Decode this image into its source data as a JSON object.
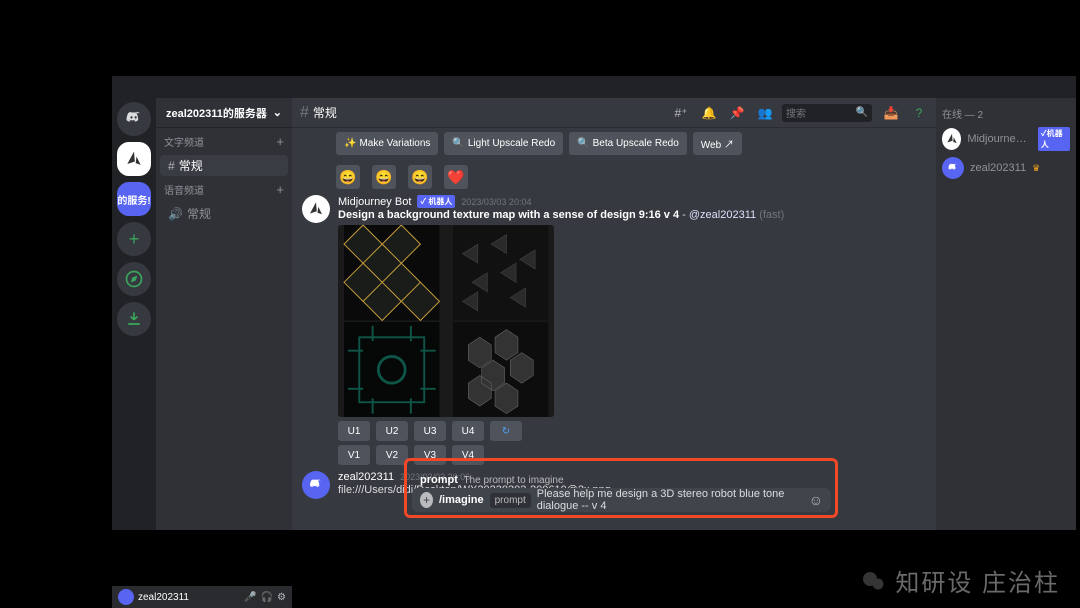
{
  "server_name": "zeal202311的服务器",
  "channel_hash": "#",
  "current_channel": "常规",
  "categories": {
    "text": {
      "label": "文字频道",
      "items": [
        {
          "name": "常规"
        }
      ]
    },
    "voice": {
      "label": "语音频道",
      "items": [
        {
          "name": "常规"
        }
      ]
    }
  },
  "header_icons": [
    "hash-icon",
    "bell-icon",
    "pin-icon",
    "members-icon"
  ],
  "search_placeholder": "搜索",
  "action_buttons": [
    {
      "icon": "✨",
      "label": "Make Variations"
    },
    {
      "icon": "🔍",
      "label": "Light Upscale Redo"
    },
    {
      "icon": "🔍",
      "label": "Beta Upscale Redo"
    },
    {
      "icon": "",
      "label": "Web ↗"
    }
  ],
  "reaction_emojis": [
    "😄",
    "😄",
    "😄",
    "❤️"
  ],
  "bot_msg": {
    "author": "Midjourney Bot",
    "bot_tag": "✓ 机器人",
    "timestamp": "2023/03/03 20:04",
    "text_prefix": "Design a background texture map with a sense of design 9:16 v 4",
    "mention": "@zeal202311",
    "suffix": "(fast)",
    "u_buttons": [
      "U1",
      "U2",
      "U3",
      "U4"
    ],
    "cycle": "↻",
    "v_buttons": [
      "V1",
      "V2",
      "V3",
      "V4"
    ]
  },
  "user_msg": {
    "author": "zeal202311",
    "timestamp": "2023/03/03 20:06",
    "text": "file:///Users/didi/Desktop/WX20230303-200610@2x.png"
  },
  "prompt_hint": {
    "label": "prompt",
    "desc": "The prompt to imagine"
  },
  "input": {
    "command": "/imagine",
    "param": "prompt",
    "value": "Please help me design a 3D stereo robot blue tone dialogue -- v 4"
  },
  "members_header": "在线 — 2",
  "members": [
    {
      "name": "Midjourney B...",
      "tag": "✓机器人",
      "av": "white"
    },
    {
      "name": "zeal202311",
      "crown": true,
      "av": "blurple"
    }
  ],
  "userbar_name": "zeal202311",
  "guild_label": "的服务!",
  "watermark": "知研设 庄治柱"
}
